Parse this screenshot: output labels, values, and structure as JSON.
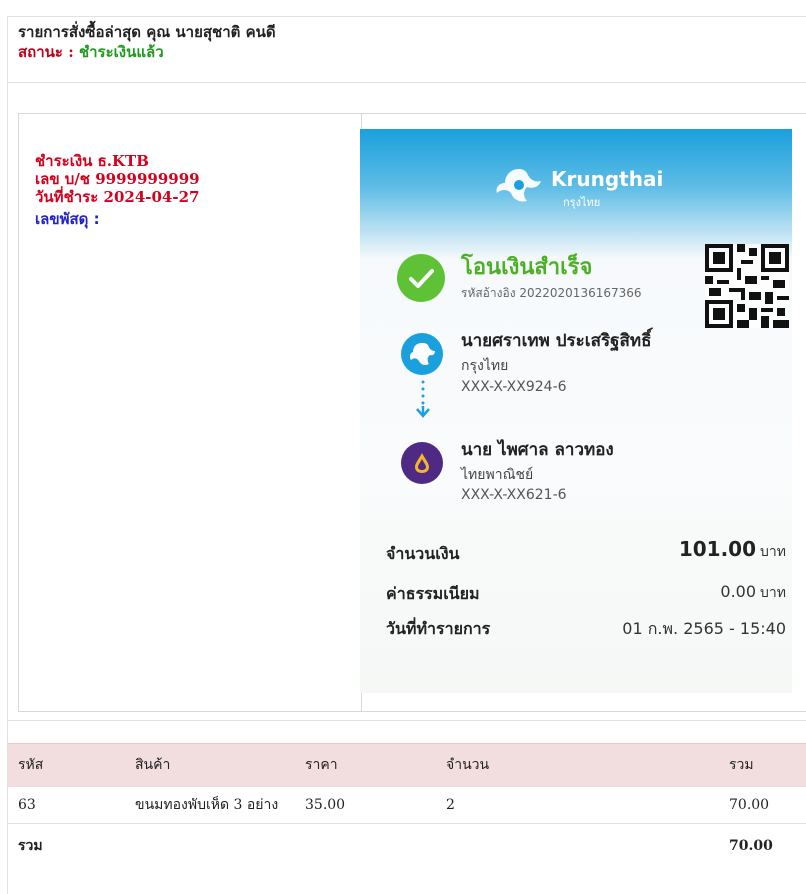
{
  "header": {
    "order_title": "รายการสั่งซื้อล่าสุด คุณ นายสุชาติ คนดี",
    "status_label": "สถานะ : ",
    "status_value": "ชำระเงินแล้ว"
  },
  "payment": {
    "method": "ชำระเงิน ธ.KTB",
    "account": "เลข บ/ช 9999999999",
    "paid_date": "วันที่ชำระ 2024-04-27",
    "tracking_label": "เลขพัสดุ :"
  },
  "slip": {
    "bank_name": "Krungthai",
    "bank_name_th": "กรุงไทย",
    "title": "โอนเงินสำเร็จ",
    "reference": "รหัสอ้างอิง 2022020136167366",
    "from": {
      "name": "นายศราเทพ ประเสริฐสิทธิ์",
      "bank": "กรุงไทย",
      "account": "XXX-X-XX924-6"
    },
    "to": {
      "name": "นาย ไพศาล ลาวทอง",
      "bank": "ไทยพาณิชย์",
      "account": "XXX-X-XX621-6"
    },
    "amount_label": "จำนวนเงิน",
    "amount": "101.00",
    "fee_label": "ค่าธรรมเนียม",
    "fee": "0.00",
    "currency": "บาท",
    "date_label": "วันที่ทำรายการ",
    "date": "01 ก.พ. 2565 - 15:40",
    "colors": {
      "ktb_blue": "#1aa0dc",
      "success_green": "#4ab125",
      "scb_purple": "#4e2a84"
    },
    "icons": [
      "check-icon",
      "qr-code-icon",
      "ktb-logo-icon",
      "scb-logo-icon",
      "arrow-down-icon"
    ]
  },
  "table": {
    "headers": [
      "รหัส",
      "สินค้า",
      "ราคา",
      "จำนวน",
      "รวม"
    ],
    "rows": [
      {
        "code": "63",
        "product": "ขนมทองพับเห็ด 3 อย่าง",
        "price": "35.00",
        "qty": "2",
        "total": "70.00"
      }
    ],
    "footer_label": "รวม",
    "footer_total": "70.00"
  }
}
